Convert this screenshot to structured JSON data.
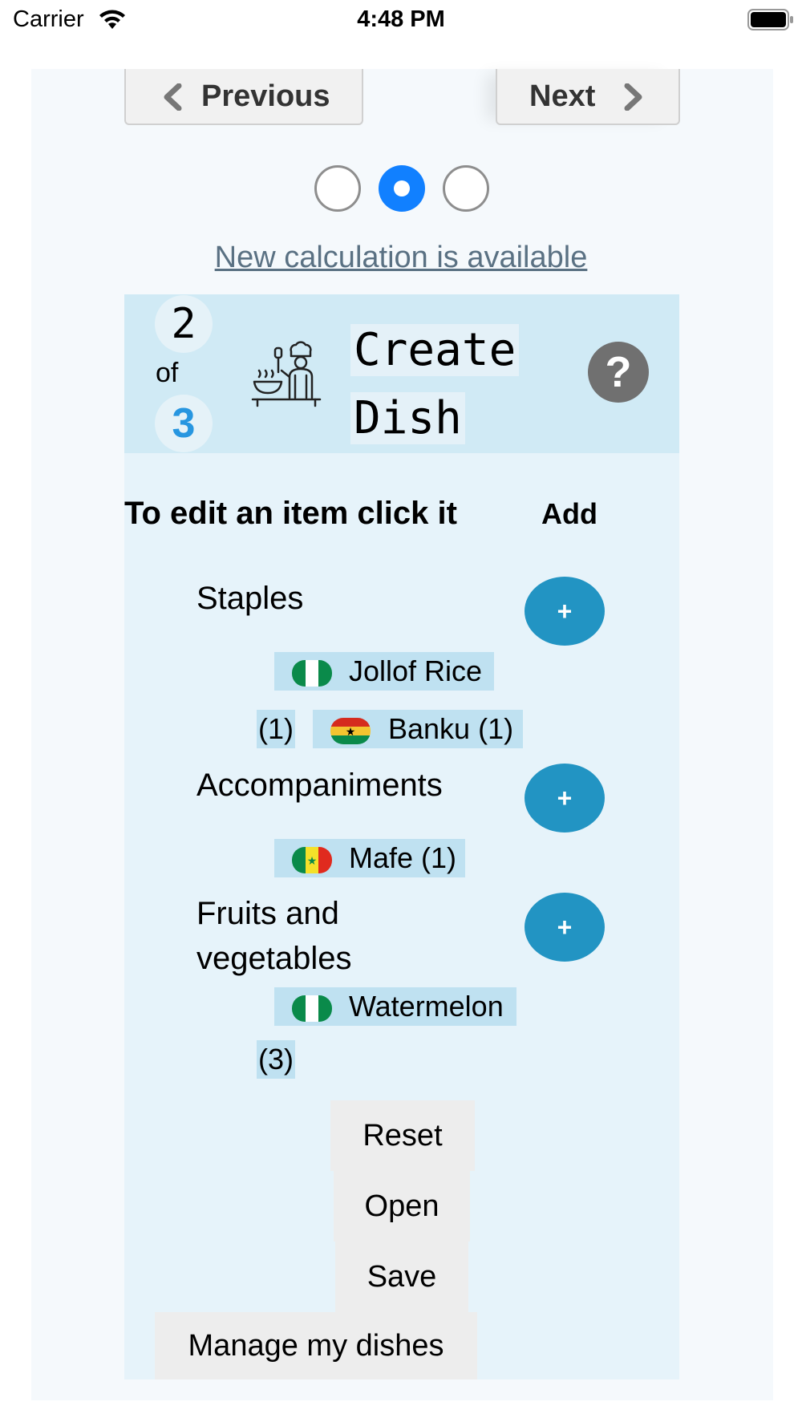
{
  "status_bar": {
    "carrier": "Carrier",
    "time": "4:48 PM"
  },
  "nav": {
    "previous_label": "Previous",
    "next_label": "Next"
  },
  "steps": {
    "current": 2,
    "total": 3,
    "active_index": 1
  },
  "notice": "New calculation is available",
  "header": {
    "current_step": "2",
    "of_label": "of",
    "total_steps": "3",
    "title_line1": "Create",
    "title_line2": "Dish",
    "help_symbol": "?",
    "chef_icon": "chef-cooking-icon"
  },
  "list_header": {
    "edit_hint": "To edit an item click it",
    "add_label": "Add"
  },
  "categories": [
    {
      "name": "Staples",
      "add_symbol": "+"
    },
    {
      "name": "Accompaniments",
      "add_symbol": "+"
    },
    {
      "name_line1": "Fruits and",
      "name_line2": "vegetables",
      "add_symbol": "+"
    }
  ],
  "items": {
    "jollof": {
      "label": "Jollof Rice",
      "count": "(1)",
      "flag": "nigeria-flag-icon"
    },
    "banku": {
      "label": "Banku (1)",
      "flag": "ghana-flag-icon"
    },
    "mafe": {
      "label": "Mafe (1)",
      "flag": "senegal-flag-icon"
    },
    "watermelon": {
      "label": "Watermelon",
      "count": "(3)",
      "flag": "nigeria-flag-icon"
    }
  },
  "actions": {
    "reset": "Reset",
    "open": "Open",
    "save": "Save",
    "manage": "Manage my dishes"
  },
  "colors": {
    "accent": "#1180ff",
    "add_button": "#2294c3",
    "panel": "#e6f3fa",
    "header": "#d0eaf5",
    "chip": "#bfe1f1"
  }
}
